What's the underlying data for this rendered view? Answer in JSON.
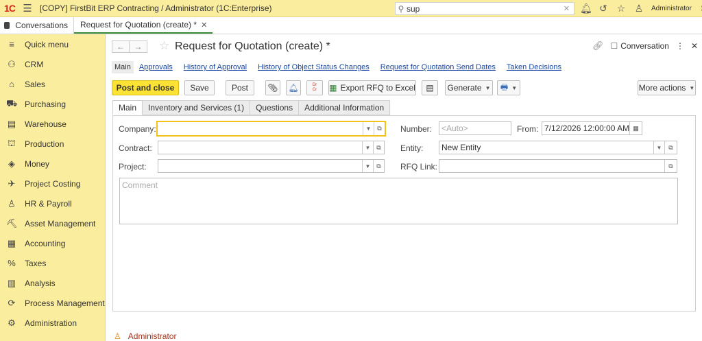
{
  "app": {
    "title": "[COPY] FirstBit ERP Contracting / Administrator  (1C:Enterprise)",
    "logo_text": "1С",
    "search_value": "sup",
    "user": "Administrator"
  },
  "tabs": {
    "conversations": "Conversations",
    "active": "Request for Quotation (create) *"
  },
  "sidebar": {
    "items": [
      {
        "label": "Quick menu",
        "icon": "menu-icon"
      },
      {
        "label": "CRM",
        "icon": "crm-icon"
      },
      {
        "label": "Sales",
        "icon": "sales-icon"
      },
      {
        "label": "Purchasing",
        "icon": "purchasing-icon"
      },
      {
        "label": "Warehouse",
        "icon": "warehouse-icon"
      },
      {
        "label": "Production",
        "icon": "production-icon"
      },
      {
        "label": "Money",
        "icon": "money-icon"
      },
      {
        "label": "Project Costing",
        "icon": "project-costing-icon"
      },
      {
        "label": "HR & Payroll",
        "icon": "hr-icon"
      },
      {
        "label": "Asset Management",
        "icon": "asset-icon"
      },
      {
        "label": "Accounting",
        "icon": "accounting-icon"
      },
      {
        "label": "Taxes",
        "icon": "taxes-icon"
      },
      {
        "label": "Analysis",
        "icon": "analysis-icon"
      },
      {
        "label": "Process Management",
        "icon": "process-icon"
      },
      {
        "label": "Administration",
        "icon": "admin-icon"
      }
    ]
  },
  "form": {
    "title": "Request for Quotation (create) *",
    "conversation_label": "Conversation",
    "subnav": {
      "main": "Main",
      "approvals": "Approvals",
      "history_approval": "History of Approval",
      "history_status": "History of Object Status Changes",
      "send_dates": "Request for Quotation Send Dates",
      "taken_decisions": "Taken Decisions"
    },
    "toolbar": {
      "post_close": "Post and close",
      "save": "Save",
      "post": "Post",
      "export": "Export RFQ to Excel",
      "generate": "Generate",
      "more_actions": "More actions",
      "drcr_top": "Dr",
      "drcr_bottom": "Cr"
    },
    "tabs": {
      "main": "Main",
      "inventory": "Inventory and Services (1)",
      "questions": "Questions",
      "additional": "Additional Information"
    },
    "fields": {
      "company_label": "Company:",
      "company_value": "",
      "contract_label": "Contract:",
      "contract_value": "",
      "project_label": "Project:",
      "project_value": "",
      "number_label": "Number:",
      "number_placeholder": "<Auto>",
      "from_label": "From:",
      "from_value": "7/12/2026 12:00:00 AM",
      "entity_label": "Entity:",
      "entity_value": "New Entity",
      "rfq_link_label": "RFQ Link:",
      "rfq_link_value": "",
      "comment_placeholder": "Comment"
    },
    "footer_user": "Administrator"
  }
}
